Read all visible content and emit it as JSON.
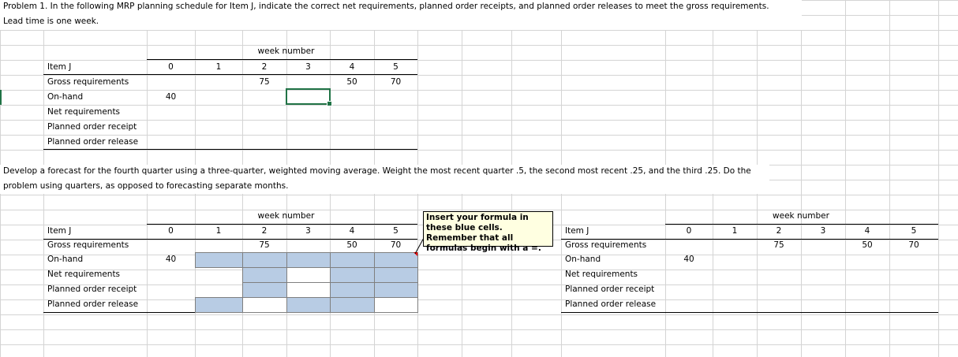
{
  "problem_text": {
    "line1": "Problem 1. In the following MRP planning schedule for Item J, indicate the correct net requirements, planned order receipts, and planned order releases to meet the gross requirements.",
    "line2": "Lead time is one week."
  },
  "forecast_text": {
    "line1": "Develop a forecast for the fourth quarter using a three-quarter, weighted moving average. Weight the most recent quarter .5, the second most recent .25, and the third .25. Do the",
    "line2": "problem using quarters, as opposed to forecasting separate months."
  },
  "table": {
    "week_header": "week number",
    "item_label": "Item J",
    "weeks": [
      "0",
      "1",
      "2",
      "3",
      "4",
      "5"
    ],
    "rows": {
      "gross": "Gross requirements",
      "onhand": "On-hand",
      "net": "Net requirements",
      "receipt": "Planned order receipt",
      "release": "Planned order release"
    },
    "gross_values": {
      "w2": "75",
      "w4": "50",
      "w5": "70"
    },
    "onhand_value": "40"
  },
  "note": {
    "text": "Insert your formula in these blue cells.  Remember that all formulas begin with a  =."
  },
  "colors": {
    "blue_cell": "#b8cce4",
    "selection": "#217346",
    "note_bg": "#ffffe1"
  }
}
